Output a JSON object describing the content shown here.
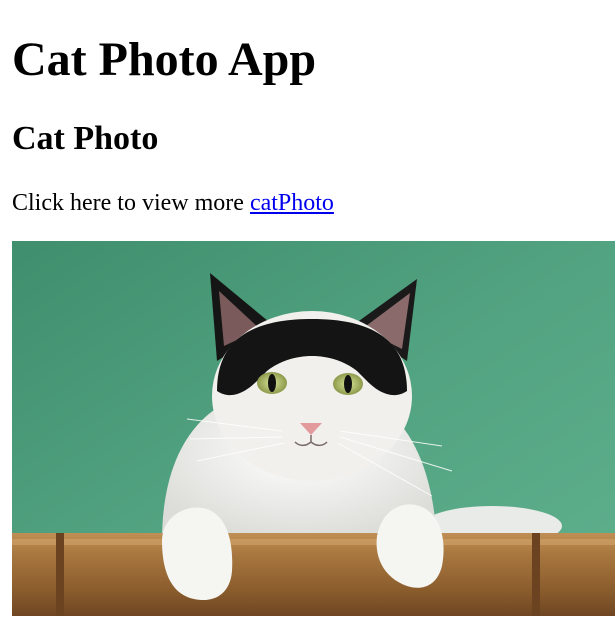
{
  "page": {
    "heading": "Cat Photo App",
    "subheading": "Cat Photo",
    "paragraph_prefix": "Click here to view more ",
    "link_text": "catPhoto"
  },
  "image": {
    "subject": "black-and-white cat leaning on bamboo rail",
    "colors": {
      "background": "#4f9e7d",
      "bamboo": "#a8783f"
    }
  }
}
